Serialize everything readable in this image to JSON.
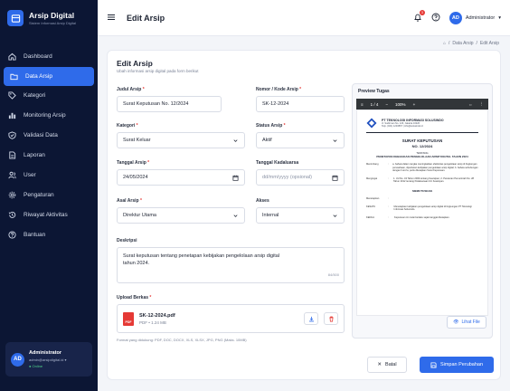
{
  "brand": {
    "title": "Arsip Digital",
    "subtitle": "Sistem Informasi Arsip Digital"
  },
  "sidebar": {
    "items": [
      {
        "label": "Dashboard",
        "icon": "home-icon"
      },
      {
        "label": "Data Arsip",
        "icon": "folder-icon"
      },
      {
        "label": "Kategori",
        "icon": "tag-icon"
      },
      {
        "label": "Monitoring Arsip",
        "icon": "bar-chart-icon"
      },
      {
        "label": "Validasi Data",
        "icon": "check-shield-icon"
      },
      {
        "label": "Laporan",
        "icon": "document-icon"
      },
      {
        "label": "User",
        "icon": "users-icon"
      },
      {
        "label": "Pengaturan",
        "icon": "gear-icon"
      },
      {
        "label": "Riwayat Aktivitas",
        "icon": "history-icon"
      },
      {
        "label": "Bantuan",
        "icon": "help-icon"
      }
    ],
    "active_index": 1
  },
  "user": {
    "initials": "AD",
    "name": "Administrator",
    "email": "admin@arsipdigital.id",
    "status": "● Online"
  },
  "topbar": {
    "title": "Edit Arsip",
    "notif_count": "3",
    "user_initials": "AD",
    "user_label": "Administrator"
  },
  "breadcrumb": {
    "home": "⌂",
    "sep": "/",
    "parent": "Data Arsip",
    "current": "Edit Arsip"
  },
  "form": {
    "title": "Edit Arsip",
    "subtitle": "Ubah informasi arsip digital pada form berikut",
    "judul": {
      "label": "Judul Arsip",
      "value": "Surat Keputusan No. 12/2024"
    },
    "nomor": {
      "label": "Nomor / Kode Arsip",
      "value": "SK-12-2024"
    },
    "kategori": {
      "label": "Kategori",
      "value": "Surat Keluar"
    },
    "status": {
      "label": "Status Arsip",
      "value": "Aktif"
    },
    "tanggal": {
      "label": "Tanggal Arsip",
      "value": "24/05/2024"
    },
    "kadaluarsa": {
      "label": "Tanggal Kadaluarsa",
      "placeholder": "dd/mm/yyyy (opsional)"
    },
    "asal": {
      "label": "Asal Arsip",
      "value": "Direktur Utama"
    },
    "akses": {
      "label": "Akses",
      "value": "Internal"
    },
    "deskripsi": {
      "label": "Deskripsi",
      "value": "Surat keputusan tentang penetapan kebijakan pengelolaan arsip digital tahun 2024.",
      "counter": "84/500"
    },
    "upload": {
      "label": "Upload Berkas",
      "file_name": "SK-12-2024.pdf",
      "file_meta": "PDF • 1.24 MB",
      "hint": "Format yang didukung: PDF, DOC, DOCX, XLS, XLSX, JPG, PNG (Maks. 10MB)"
    },
    "required_mark": "*"
  },
  "preview": {
    "title": "Preview Tugas",
    "page": "1 / 4",
    "zoom": "100%",
    "org": "PT TEKNOLOGI INFORMASI SOLUSINDO",
    "addr1": "Jl. Sudirman No. 123, Jakarta 10220",
    "addr2": "Telp. (021) 1234567 | info@solusindo.id",
    "doc_title": "SURAT KEPUTUSAN",
    "doc_no": "NO. 12/2024",
    "doc_tentang": "TENTANG",
    "doc_subject": "PENETAPAN KEBIJAKAN PENGELOLAAN ARSIP DIGITAL TAHUN 2024",
    "menimbang_k": "Menimbang",
    "menimbang_v": "a. bahwa dalam rangka meningkatkan efektivitas pengelolaan arsip di lingkungan perusahaan, diperlukan kebijakan pengelolaan arsip digital; b. bahwa sehubungan dengan huruf a, perlu ditetapkan Surat Keputusan.",
    "mengingat_k": "Mengingat",
    "mengingat_v": "1. UU No. 43 Tahun 2009 tentang Kearsipan; 2. Peraturan Pemerintah No. 28 Tahun 2012 tentang Pelaksanaan UU Kearsipan.",
    "memutuskan": "MEMUTUSKAN",
    "menetapkan_k": "Menetapkan",
    "kesatu_k": "KESATU",
    "kesatu_v": "Menetapkan kebijakan pengelolaan arsip digital di lingkungan PT Teknologi Informasi Solusindo.",
    "kedua_k": "KEDUA",
    "kedua_v": "Keputusan ini mulai berlaku sejak tanggal ditetapkan.",
    "view_label": "Lihat File"
  },
  "actions": {
    "cancel": "Batal",
    "save": "Simpan Perubahan"
  },
  "colors": {
    "primary": "#2f6bea",
    "sidebar": "#0c1634",
    "danger": "#e53935"
  }
}
